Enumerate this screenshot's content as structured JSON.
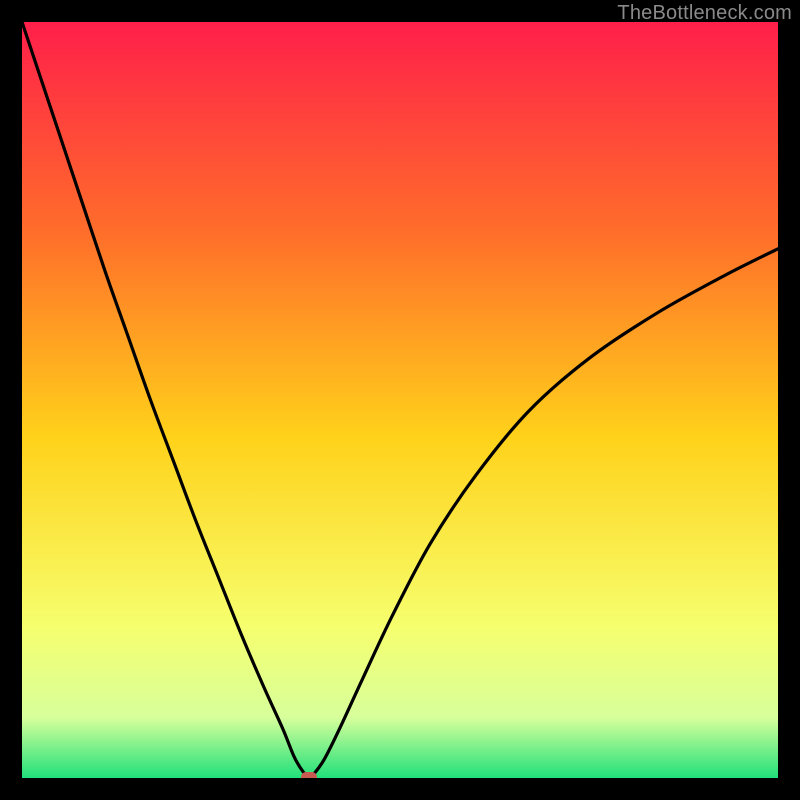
{
  "watermark": "TheBottleneck.com",
  "colors": {
    "top": "#ff1f4a",
    "midUpper": "#ff6e2a",
    "mid": "#ffd21a",
    "lower1": "#f6ff6e",
    "lower2": "#d7ff9b",
    "bottom": "#20e07a",
    "curve": "#000000",
    "marker": "#c85a52",
    "frame": "#000000"
  },
  "chart_data": {
    "type": "line",
    "title": "",
    "xlabel": "",
    "ylabel": "",
    "xlim": [
      0,
      100
    ],
    "ylim": [
      0,
      100
    ],
    "legend": false,
    "grid": false,
    "series": [
      {
        "name": "bottleneck-curve",
        "x": [
          0,
          2,
          5,
          8,
          11,
          14,
          17,
          20,
          23,
          26,
          29,
          32,
          34.5,
          36,
          37.2,
          38,
          38.5,
          40,
          42,
          45,
          49,
          54,
          60,
          67,
          75,
          84,
          93,
          100
        ],
        "y": [
          100,
          94,
          85,
          76,
          67,
          58.5,
          50,
          42,
          34,
          26.5,
          19,
          12,
          6.5,
          2.8,
          0.8,
          0.1,
          0.4,
          2.5,
          6.5,
          13,
          21.5,
          31,
          40,
          48.5,
          55.5,
          61.5,
          66.5,
          70
        ]
      }
    ],
    "marker": {
      "x": 38,
      "y": 0.1
    },
    "gradient_stops": [
      {
        "pos": 0.0,
        "color": "#ff1f4a"
      },
      {
        "pos": 0.28,
        "color": "#ff6e2a"
      },
      {
        "pos": 0.55,
        "color": "#ffd21a"
      },
      {
        "pos": 0.8,
        "color": "#f6ff6e"
      },
      {
        "pos": 0.92,
        "color": "#d7ff9b"
      },
      {
        "pos": 1.0,
        "color": "#20e07a"
      }
    ]
  }
}
